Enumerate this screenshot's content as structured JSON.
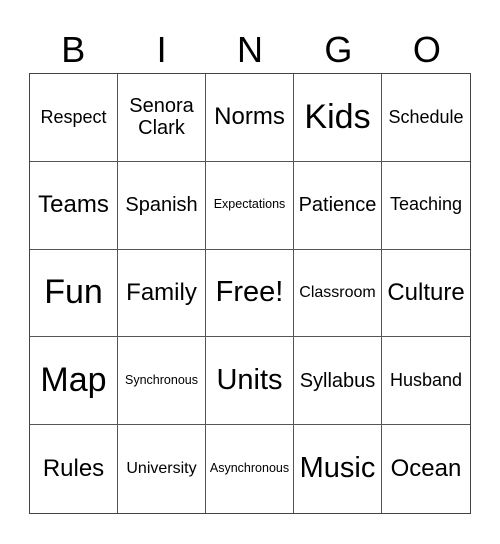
{
  "header": [
    "B",
    "I",
    "N",
    "G",
    "O"
  ],
  "cells": [
    {
      "text": "Respect",
      "size": "s-s"
    },
    {
      "text": "Senora Clark",
      "size": "s-n"
    },
    {
      "text": "Norms",
      "size": "s-m"
    },
    {
      "text": "Kids",
      "size": "s-xl"
    },
    {
      "text": "Schedule",
      "size": "s-s"
    },
    {
      "text": "Teams",
      "size": "s-m"
    },
    {
      "text": "Spanish",
      "size": "s-n"
    },
    {
      "text": "Expectations",
      "size": "s-t"
    },
    {
      "text": "Patience",
      "size": "s-n"
    },
    {
      "text": "Teaching",
      "size": "s-s"
    },
    {
      "text": "Fun",
      "size": "s-xl"
    },
    {
      "text": "Family",
      "size": "s-m"
    },
    {
      "text": "Free!",
      "size": "s-l"
    },
    {
      "text": "Classroom",
      "size": "s-xs"
    },
    {
      "text": "Culture",
      "size": "s-m"
    },
    {
      "text": "Map",
      "size": "s-xl"
    },
    {
      "text": "Synchronous",
      "size": "s-t"
    },
    {
      "text": "Units",
      "size": "s-l"
    },
    {
      "text": "Syllabus",
      "size": "s-n"
    },
    {
      "text": "Husband",
      "size": "s-s"
    },
    {
      "text": "Rules",
      "size": "s-m"
    },
    {
      "text": "University",
      "size": "s-xs"
    },
    {
      "text": "Asynchronous",
      "size": "s-t"
    },
    {
      "text": "Music",
      "size": "s-l"
    },
    {
      "text": "Ocean",
      "size": "s-m"
    }
  ]
}
